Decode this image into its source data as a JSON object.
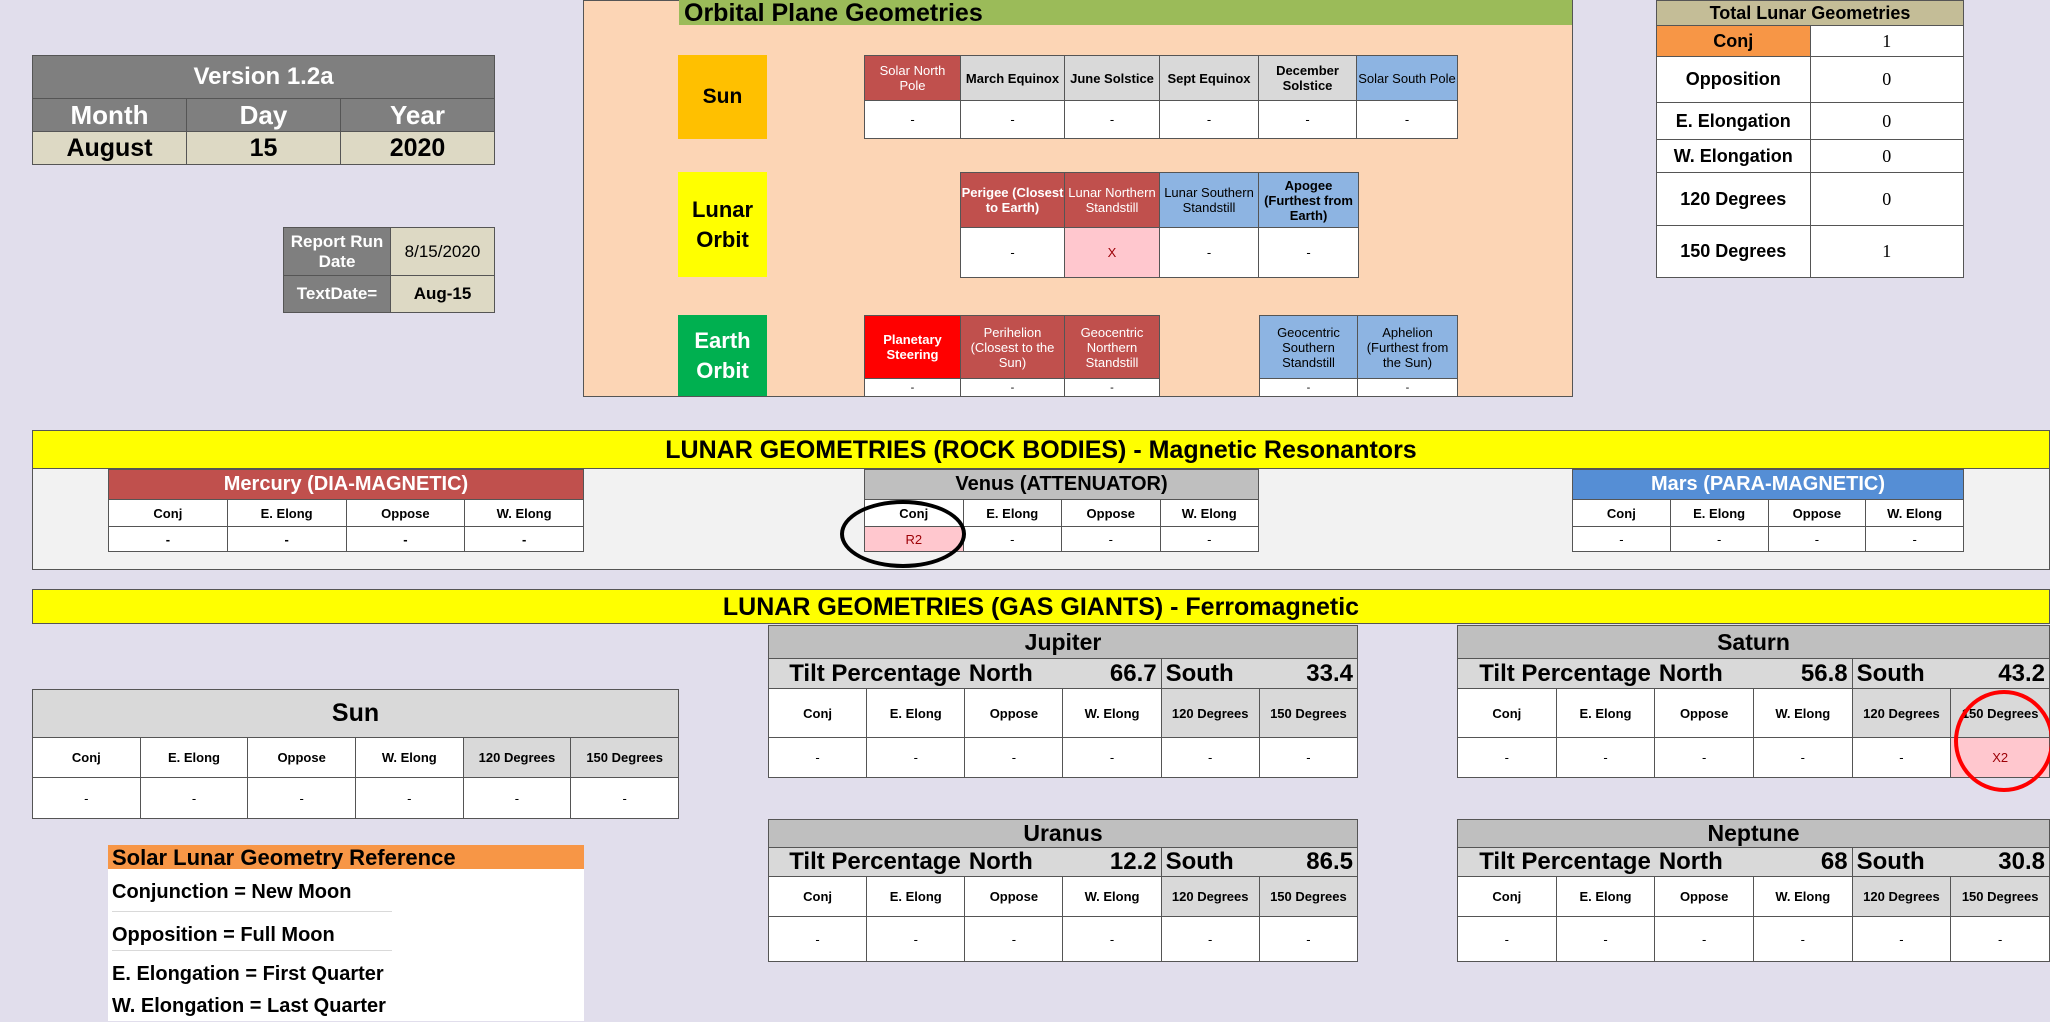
{
  "version": {
    "title": "Version 1.2a",
    "month_label": "Month",
    "day_label": "Day",
    "year_label": "Year",
    "month": "August",
    "day": "15",
    "year": "2020"
  },
  "report": {
    "run_date_label": "Report Run Date",
    "run_date": "8/15/2020",
    "textdate_label": "TextDate=",
    "textdate": "Aug-15"
  },
  "orbital": {
    "title": "Orbital Plane Geometries",
    "sun": {
      "label": "Sun",
      "headers": [
        "Solar North Pole",
        "March Equinox",
        "June Solstice",
        "Sept Equinox",
        "December Solstice",
        "Solar South Pole"
      ],
      "values": [
        "-",
        "-",
        "-",
        "-",
        "-",
        "-"
      ]
    },
    "lunar": {
      "label1": "Lunar",
      "label2": "Orbit",
      "headers": [
        "Perigee (Closest to Earth)",
        "Lunar Northern Standstill",
        "Lunar Southern Standstill",
        "Apogee (Furthest from Earth)"
      ],
      "values": [
        "-",
        "X",
        "-",
        "-"
      ]
    },
    "earth": {
      "label1": "Earth",
      "label2": "Orbit",
      "headers_left": [
        "Planetary Steering",
        "Perihelion (Closest to the Sun)",
        "Geocentric Northern Standstill"
      ],
      "headers_right": [
        "Geocentric Southern Standstill",
        "Aphelion (Furthest from the Sun)"
      ],
      "values_left": [
        "-",
        "-",
        "-"
      ],
      "values_right": [
        "-",
        "-"
      ]
    }
  },
  "totals": {
    "title": "Total Lunar Geometries",
    "rows": [
      {
        "label": "Conj",
        "value": "1"
      },
      {
        "label": "Opposition",
        "value": "0"
      },
      {
        "label": "E. Elongation",
        "value": "0"
      },
      {
        "label": "W. Elongation",
        "value": "0"
      },
      {
        "label": "120 Degrees",
        "value": "0"
      },
      {
        "label": "150 Degrees",
        "value": "1"
      }
    ]
  },
  "rock": {
    "title": "LUNAR GEOMETRIES (ROCK BODIES) - Magnetic Resonantors",
    "mercury": {
      "title": "Mercury (DIA-MAGNETIC)",
      "headers": [
        "Conj",
        "E. Elong",
        "Oppose",
        "W. Elong"
      ],
      "values": [
        "-",
        "-",
        "-",
        "-"
      ]
    },
    "venus": {
      "title": "Venus (ATTENUATOR)",
      "headers": [
        "Conj",
        "E. Elong",
        "Oppose",
        "W. Elong"
      ],
      "values": [
        "R2",
        "-",
        "-",
        "-"
      ]
    },
    "mars": {
      "title": "Mars (PARA-MAGNETIC)",
      "headers": [
        "Conj",
        "E. Elong",
        "Oppose",
        "W. Elong"
      ],
      "values": [
        "-",
        "-",
        "-",
        "-"
      ]
    }
  },
  "gas": {
    "title": "LUNAR GEOMETRIES (GAS GIANTS) - Ferromagnetic",
    "headers": [
      "Conj",
      "E. Elong",
      "Oppose",
      "W. Elong",
      "120 Degrees",
      "150 Degrees"
    ],
    "tilt_label": "Tilt Percentage",
    "north_label": "North",
    "south_label": "South",
    "sun": {
      "title": "Sun",
      "values": [
        "-",
        "-",
        "-",
        "-",
        "-",
        "-"
      ]
    },
    "jupiter": {
      "title": "Jupiter",
      "north": "66.7",
      "south": "33.4",
      "values": [
        "-",
        "-",
        "-",
        "-",
        "-",
        "-"
      ]
    },
    "saturn": {
      "title": "Saturn",
      "north": "56.8",
      "south": "43.2",
      "values": [
        "-",
        "-",
        "-",
        "-",
        "-",
        "X2"
      ]
    },
    "uranus": {
      "title": "Uranus",
      "north": "12.2",
      "south": "86.5",
      "values": [
        "-",
        "-",
        "-",
        "-",
        "-",
        "-"
      ]
    },
    "neptune": {
      "title": "Neptune",
      "north": "68",
      "south": "30.8",
      "values": [
        "-",
        "-",
        "-",
        "-",
        "-",
        "-"
      ]
    }
  },
  "reference": {
    "title": "Solar Lunar Geometry Reference",
    "lines": [
      "Conjunction = New Moon",
      "Opposition = Full Moon",
      "E. Elongation = First Quarter",
      "W. Elongation = Last Quarter"
    ]
  },
  "colors": {
    "background": "#e1deec",
    "section_yellow": "#ffff00",
    "highlight_pink": "#ffc7ce",
    "mercury_red": "#c0504d",
    "mars_blue": "#558ed5",
    "orbital_bg": "#fcd5b5",
    "orbital_green": "#9bbb59",
    "sun_orange": "#ffc000",
    "earth_green": "#00b050"
  }
}
